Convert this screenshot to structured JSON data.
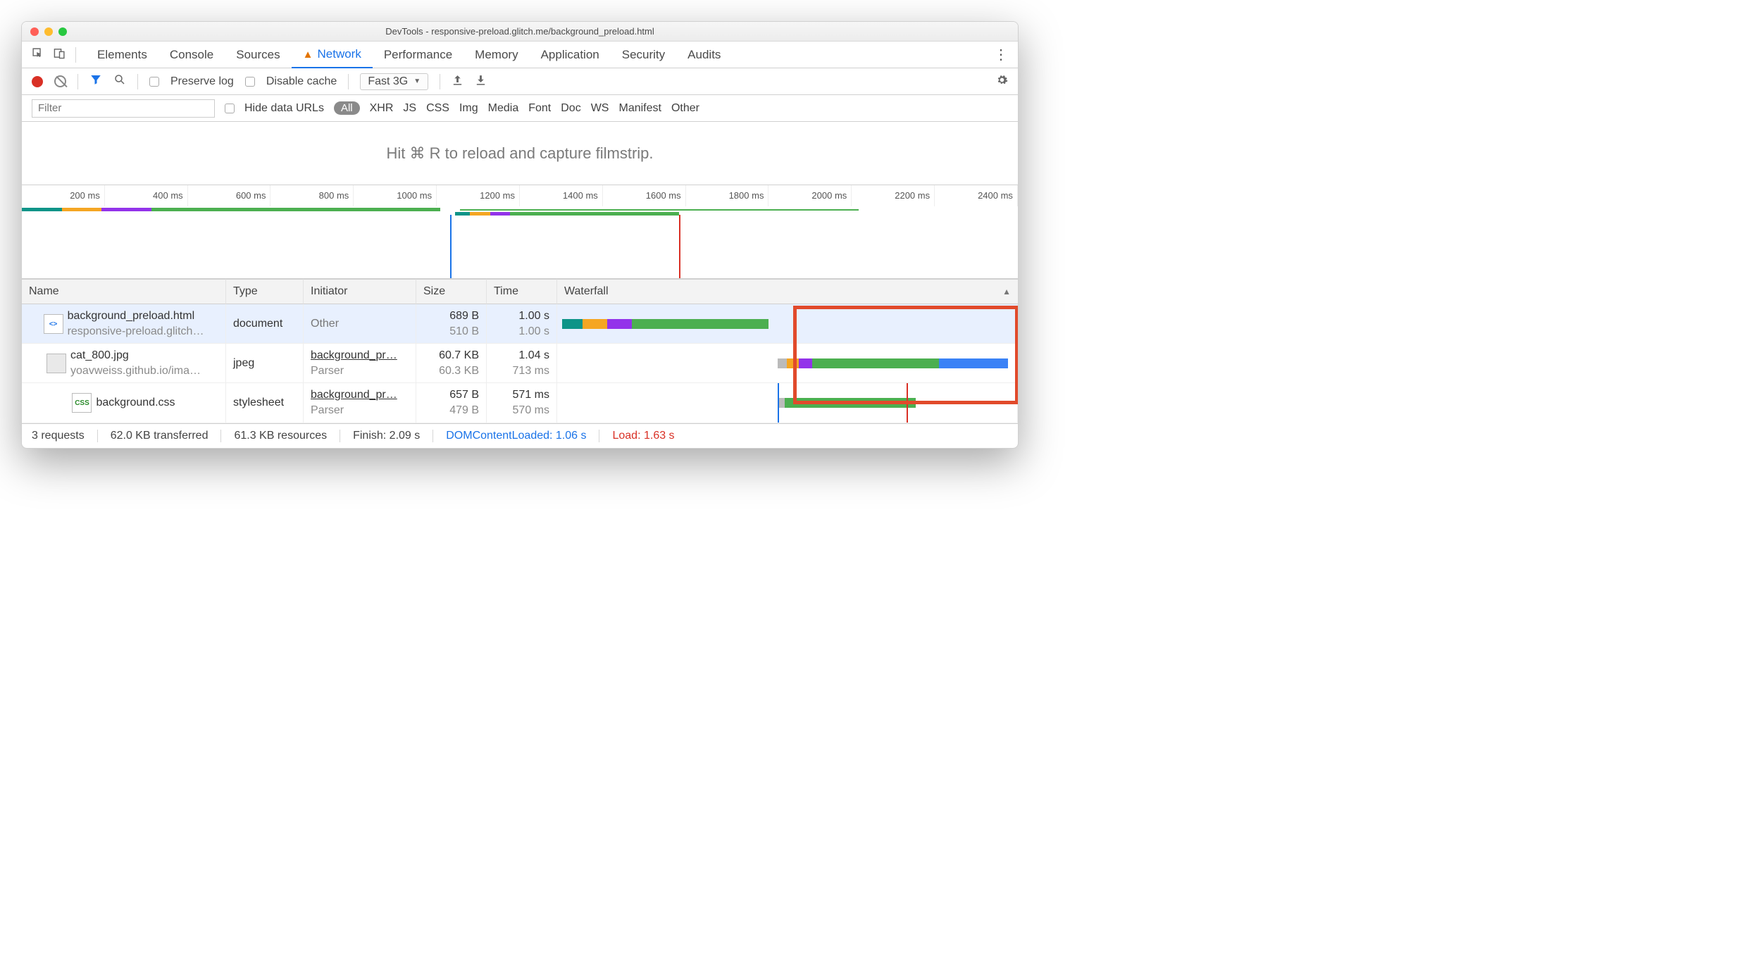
{
  "title": "DevTools - responsive-preload.glitch.me/background_preload.html",
  "tabs": [
    "Elements",
    "Console",
    "Sources",
    "Network",
    "Performance",
    "Memory",
    "Application",
    "Security",
    "Audits"
  ],
  "activeTab": "Network",
  "toolbar": {
    "preserve_log": "Preserve log",
    "disable_cache": "Disable cache",
    "throttling": "Fast 3G"
  },
  "filter": {
    "placeholder": "Filter",
    "hide_data_urls": "Hide data URLs",
    "all": "All",
    "types": [
      "XHR",
      "JS",
      "CSS",
      "Img",
      "Media",
      "Font",
      "Doc",
      "WS",
      "Manifest",
      "Other"
    ]
  },
  "filmstrip_hint": "Hit ⌘ R to reload and capture filmstrip.",
  "ruler": [
    "200 ms",
    "400 ms",
    "600 ms",
    "800 ms",
    "1000 ms",
    "1200 ms",
    "1400 ms",
    "1600 ms",
    "1800 ms",
    "2000 ms",
    "2200 ms",
    "2400 ms"
  ],
  "columns": {
    "name": "Name",
    "type": "Type",
    "initiator": "Initiator",
    "size": "Size",
    "time": "Time",
    "waterfall": "Waterfall"
  },
  "rows": [
    {
      "name": "background_preload.html",
      "sub": "responsive-preload.glitch…",
      "type": "document",
      "initiator": "Other",
      "initiator_sub": "",
      "size": "689 B",
      "size_sub": "510 B",
      "time": "1.00 s",
      "time_sub": "1.00 s",
      "selected": true
    },
    {
      "name": "cat_800.jpg",
      "sub": "yoavweiss.github.io/ima…",
      "type": "jpeg",
      "initiator": "background_pr…",
      "initiator_sub": "Parser",
      "size": "60.7 KB",
      "size_sub": "60.3 KB",
      "time": "1.04 s",
      "time_sub": "713 ms",
      "selected": false
    },
    {
      "name": "background.css",
      "sub": "",
      "type": "stylesheet",
      "initiator": "background_pr…",
      "initiator_sub": "Parser",
      "size": "657 B",
      "size_sub": "479 B",
      "time": "571 ms",
      "time_sub": "570 ms",
      "selected": false
    }
  ],
  "status": {
    "requests": "3 requests",
    "transferred": "62.0 KB transferred",
    "resources": "61.3 KB resources",
    "finish": "Finish: 2.09 s",
    "dcl": "DOMContentLoaded: 1.06 s",
    "load": "Load: 1.63 s"
  }
}
